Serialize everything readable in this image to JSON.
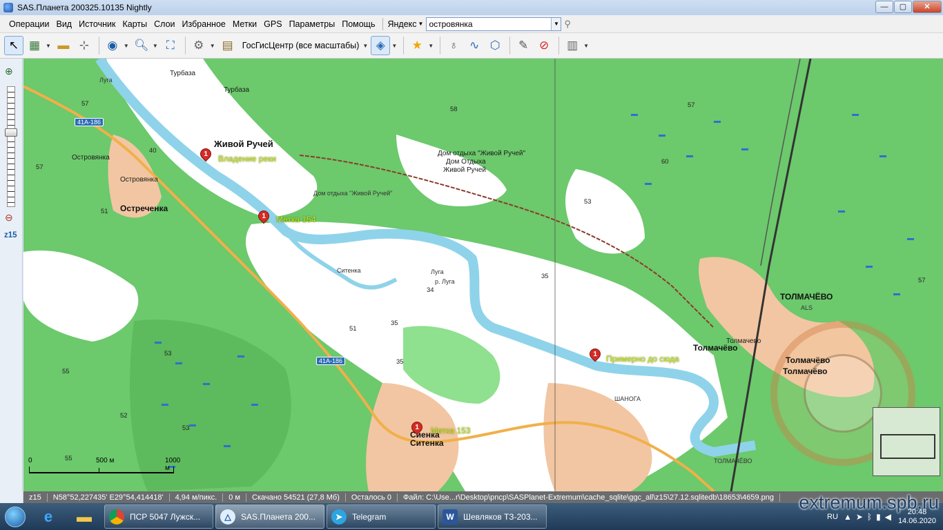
{
  "window": {
    "title": "SAS.Планета 200325.10135 Nightly",
    "controls": {
      "minimize": "—",
      "maximize": "▢",
      "close": "✕"
    }
  },
  "menu": {
    "items": [
      "Операции",
      "Вид",
      "Источник",
      "Карты",
      "Слои",
      "Избранное",
      "Метки",
      "GPS",
      "Параметры",
      "Помощь"
    ],
    "search_provider": "Яндекс",
    "search_value": "островянка"
  },
  "toolbar": {
    "map_source": "ГосГисЦентр (все масштабы)"
  },
  "zoom": {
    "level": "z15"
  },
  "map": {
    "labels": {
      "turbaza1": "Турбаза",
      "turbaza2": "Турбаза",
      "zhivoy_ruchey": "Живой Ручей",
      "vladenie_reki": "Владение реки",
      "ostrovyanka1": "Островянка",
      "ostrovyanka2": "Островянка",
      "ostrechenka": "Остреченка",
      "metka154": "Метка 154",
      "dom_otdykha1": "Дом отдыха \"Живой Ручей\"",
      "dom_otdykha2": "Дом Отдыха",
      "dom_otdykha3": "Живой Ручей",
      "dom_otdykha4": "Дом отдыха \"Живой Ручей\"",
      "tolmachevo1": "ТОЛМАЧЁВО",
      "tolmachevo2": "Толмачёво",
      "tolmachevo3": "Толмачево",
      "tolmachevo4": "Толмачёво",
      "tolmachevo5": "ТОЛМАЧЁВО",
      "primerno": "Примерно до сюда",
      "sitenka1": "Сиенка",
      "sitenka2": "Ситенка",
      "metka153": "Метка 153",
      "luga1": "Луга",
      "luga2": "р. Луга",
      "luga3": "Луга",
      "sitenka_river": "Ситенка",
      "shanoga": "ШАНОГА",
      "als": "ALS"
    },
    "heights": [
      "57",
      "58",
      "57",
      "60",
      "53",
      "57",
      "35",
      "34",
      "35",
      "55",
      "53",
      "52",
      "53",
      "55",
      "51",
      "40",
      "57",
      "51",
      "35"
    ],
    "road_badges": [
      "41А-186",
      "41А-186"
    ],
    "pins": [
      "1",
      "1",
      "1",
      "1"
    ],
    "scale": {
      "zero": "0",
      "mid": "500 м",
      "end": "1000 м"
    }
  },
  "status": {
    "zoom": "z15",
    "coords": "N58°52,227435' E29°54,414418'",
    "resolution": "4,94 м/пикс.",
    "distance": "0 м",
    "scanned": "Скачано 54521 (27,8 Мб)",
    "remaining": "Осталось 0",
    "file": "Файл: C:\\Use...r\\Desktop\\pncp\\SASPlanet-Extremum\\cache_sqlite\\ggc_all\\z15\\27.12.sqlitedb\\18653\\4659.png"
  },
  "taskbar": {
    "tasks": [
      {
        "label": "ПСР 5047 Лужск...",
        "icon": "chrome-icon"
      },
      {
        "label": "SAS.Планета 200...",
        "icon": "sasplanet-icon"
      },
      {
        "label": "Telegram",
        "icon": "telegram-icon"
      },
      {
        "label": "Шевляков ТЗ-203...",
        "icon": "word-icon"
      }
    ],
    "lang": "RU",
    "time": "20:48",
    "date": "14.06.2020"
  },
  "watermark": "extremum.spb.ru",
  "colors": {
    "forest": "#6cc96c",
    "field": "#ffffff",
    "river": "#8fd3ea",
    "settlement": "#f2c6a2",
    "road": "#f0b04a",
    "swamp": "#3c7fd6"
  }
}
